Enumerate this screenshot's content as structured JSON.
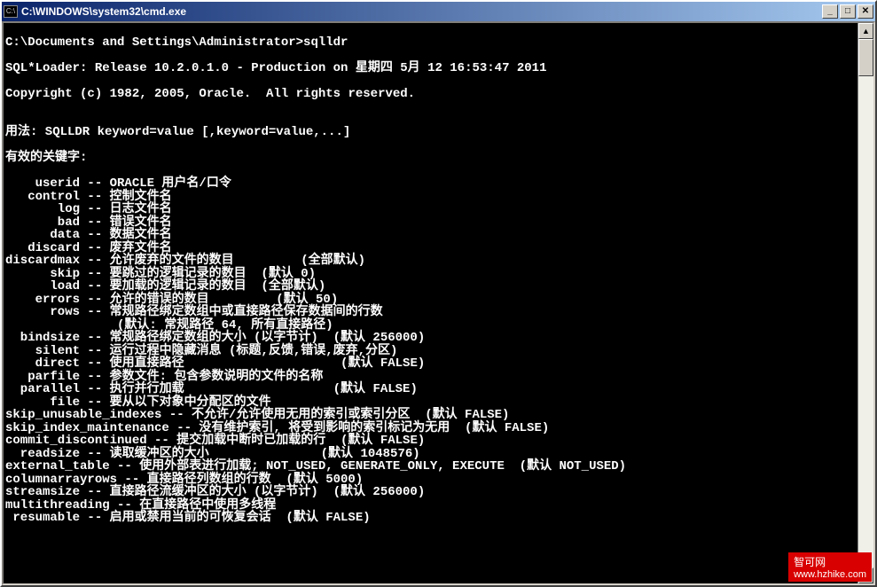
{
  "window": {
    "title": "C:\\WINDOWS\\system32\\cmd.exe",
    "icon_text": "C:\\"
  },
  "controls": {
    "minimize": "_",
    "maximize": "□",
    "close": "✕"
  },
  "terminal": {
    "prompt": "C:\\Documents and Settings\\Administrator>sqlldr",
    "version": "SQL*Loader: Release 10.2.0.1.0 - Production on 星期四 5月 12 16:53:47 2011",
    "copyright": "Copyright (c) 1982, 2005, Oracle.  All rights reserved.",
    "usage": "用法: SQLLDR keyword=value [,keyword=value,...]",
    "keywords_header": "有效的关键字:",
    "blank": "",
    "lines": [
      "    userid -- ORACLE 用户名/口令",
      "   control -- 控制文件名",
      "       log -- 日志文件名",
      "       bad -- 错误文件名",
      "      data -- 数据文件名",
      "   discard -- 废弃文件名",
      "discardmax -- 允许废弃的文件的数目         (全部默认)",
      "      skip -- 要跳过的逻辑记录的数目  (默认 0)",
      "      load -- 要加载的逻辑记录的数目  (全部默认)",
      "    errors -- 允许的错误的数目         (默认 50)",
      "      rows -- 常规路径绑定数组中或直接路径保存数据间的行数",
      "               (默认: 常规路径 64, 所有直接路径)",
      "  bindsize -- 常规路径绑定数组的大小 (以字节计)  (默认 256000)",
      "    silent -- 运行过程中隐藏消息 (标题,反馈,错误,废弃,分区)",
      "    direct -- 使用直接路径                     (默认 FALSE)",
      "   parfile -- 参数文件: 包含参数说明的文件的名称",
      "  parallel -- 执行并行加载                    (默认 FALSE)",
      "      file -- 要从以下对象中分配区的文件",
      "skip_unusable_indexes -- 不允许/允许使用无用的索引或索引分区  (默认 FALSE)",
      "skip_index_maintenance -- 没有维护索引, 将受到影响的索引标记为无用  (默认 FALSE)",
      "commit_discontinued -- 提交加载中断时已加载的行  (默认 FALSE)",
      "  readsize -- 读取缓冲区的大小               (默认 1048576)",
      "external_table -- 使用外部表进行加载; NOT_USED, GENERATE_ONLY, EXECUTE  (默认 NOT_USED)",
      "columnarrayrows -- 直接路径列数组的行数  (默认 5000)",
      "streamsize -- 直接路径流缓冲区的大小 (以字节计)  (默认 256000)",
      "multithreading -- 在直接路径中使用多线程",
      " resumable -- 启用或禁用当前的可恢复会话  (默认 FALSE)"
    ]
  },
  "watermark": {
    "top": "智可网",
    "bot": "www.hzhike.com"
  }
}
